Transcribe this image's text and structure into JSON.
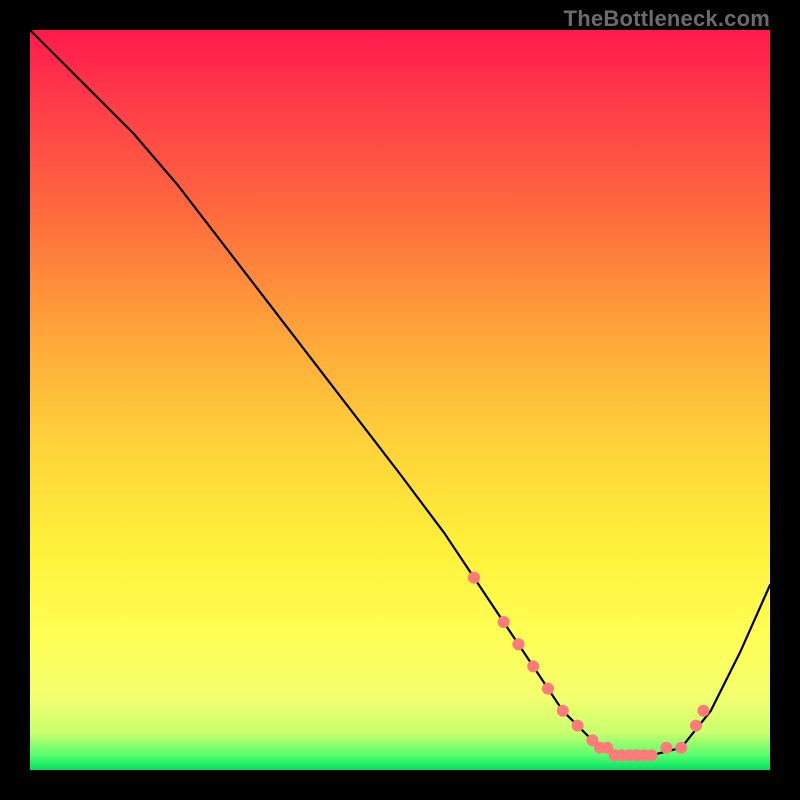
{
  "watermark": "TheBottleneck.com",
  "colors": {
    "frame": "#000000",
    "gradient_top": "#ff1a4d",
    "gradient_bottom": "#00e060",
    "curve": "#000000",
    "dots": "#ff7a7a"
  },
  "chart_data": {
    "type": "line",
    "title": "",
    "xlabel": "",
    "ylabel": "",
    "xlim": [
      0,
      100
    ],
    "ylim": [
      0,
      100
    ],
    "grid": false,
    "legend": false,
    "series": [
      {
        "name": "curve",
        "x": [
          0,
          4,
          8,
          10,
          14,
          20,
          30,
          40,
          50,
          56,
          60,
          64,
          68,
          72,
          76,
          80,
          84,
          88,
          92,
          96,
          100
        ],
        "y": [
          100,
          96,
          92,
          90,
          86,
          79,
          66,
          53,
          40,
          32,
          26,
          20,
          14,
          8,
          4,
          2,
          2,
          3,
          8,
          16,
          25
        ]
      }
    ],
    "dots": {
      "name": "highlight-dots",
      "x": [
        60,
        64,
        66,
        68,
        70,
        72,
        74,
        76,
        77,
        78,
        79,
        80,
        81,
        82,
        83,
        84,
        86,
        88,
        90,
        91
      ],
      "y": [
        26,
        20,
        17,
        14,
        11,
        8,
        6,
        4,
        3,
        3,
        2,
        2,
        2,
        2,
        2,
        2,
        3,
        3,
        6,
        8
      ]
    }
  }
}
